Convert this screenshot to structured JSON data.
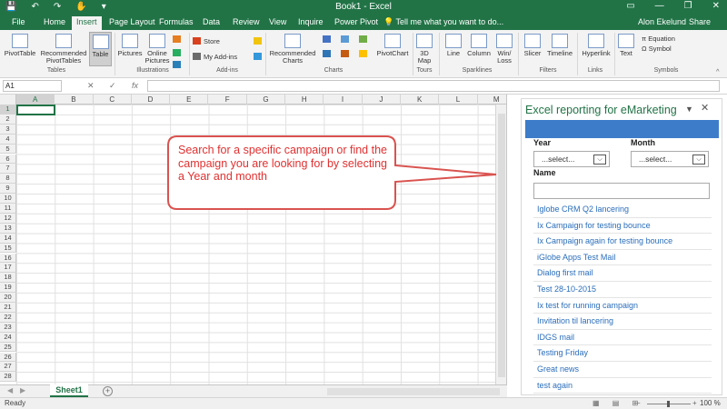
{
  "window": {
    "title": "Book1 - Excel",
    "qat": [
      "💾",
      "↶",
      "↷",
      "✋",
      "▾"
    ],
    "controls": [
      "▭",
      "—",
      "❐",
      "✕"
    ]
  },
  "tabs": [
    "File",
    "Home",
    "Insert",
    "Page Layout",
    "Formulas",
    "Data",
    "Review",
    "View",
    "Inquire",
    "Power Pivot"
  ],
  "active_tab": "Insert",
  "tell_me": "💡 Tell me what you want to do...",
  "user": "Alon Ekelund",
  "share": "Share",
  "ribbon": {
    "pivottable": "PivotTable",
    "recommended_pivottables": [
      "Recommended",
      "PivotTables"
    ],
    "table": "Table",
    "pictures": "Pictures",
    "online_pictures": [
      "Online",
      "Pictures"
    ],
    "store": "Store",
    "my_addins": "My Add-ins",
    "recommended_charts": [
      "Recommended",
      "Charts"
    ],
    "pivotchart": "PivotChart",
    "map3d": [
      "3D",
      "Map"
    ],
    "line": "Line",
    "column": "Column",
    "winloss": [
      "Win/",
      "Loss"
    ],
    "slicer": "Slicer",
    "timeline": "Timeline",
    "hyperlink": "Hyperlink",
    "text": "Text",
    "equation": "π Equation",
    "symbol": "Ω Symbol",
    "groups": [
      "Tables",
      "Illustrations",
      "Add-ins",
      "Charts",
      "Tours",
      "Sparklines",
      "Filters",
      "Links",
      "Symbols"
    ]
  },
  "formula_bar": {
    "namebox": "A1",
    "cancel": "✕",
    "enter": "✓",
    "fx": "fx",
    "value": ""
  },
  "grid": {
    "columns": [
      "A",
      "B",
      "C",
      "D",
      "E",
      "F",
      "G",
      "H",
      "I",
      "J",
      "K",
      "L",
      "M"
    ],
    "rows": [
      "1",
      "2",
      "3",
      "4",
      "5",
      "6",
      "7",
      "8",
      "9",
      "10",
      "11",
      "12",
      "13",
      "14",
      "15",
      "16",
      "17",
      "18",
      "19",
      "20",
      "21",
      "22",
      "23",
      "24",
      "25",
      "26",
      "27",
      "28"
    ],
    "active_cell": "A1"
  },
  "callout": {
    "text": "Search for a specific campaign or find the campaign you are looking for by selecting a Year and month",
    "color": "#e03131"
  },
  "sheets": {
    "nav": [
      "◀",
      "▶"
    ],
    "tabs": [
      "Sheet1"
    ],
    "add": "+"
  },
  "status": {
    "ready": "Ready",
    "views": "▦ ▤ ⊞",
    "zoom_minus": "−",
    "zoom_plus": "+",
    "zoom": "100 %"
  },
  "pane": {
    "title": "Excel reporting for eMarketing",
    "arrow": "▼",
    "close": "✕",
    "banner_color": "#3d7cc9",
    "year_label": "Year",
    "month_label": "Month",
    "year_value": "...select...",
    "month_value": "...select...",
    "dropdown_glyph": "⌵",
    "name_label": "Name",
    "name_value": "",
    "campaigns": [
      "Iglobe CRM Q2 lancering",
      "Ix Campaign for testing bounce",
      "Ix Campaign again for testing bounce",
      "iGlobe Apps Test Mail",
      "Dialog first mail",
      "Test 28-10-2015",
      "Ix test for running campaign",
      "Invitation til lancering",
      "IDGS mail",
      "Testing Friday",
      "Great news",
      "test again"
    ]
  },
  "colors": {
    "accent": "#217346",
    "link": "#2a6ebb"
  }
}
